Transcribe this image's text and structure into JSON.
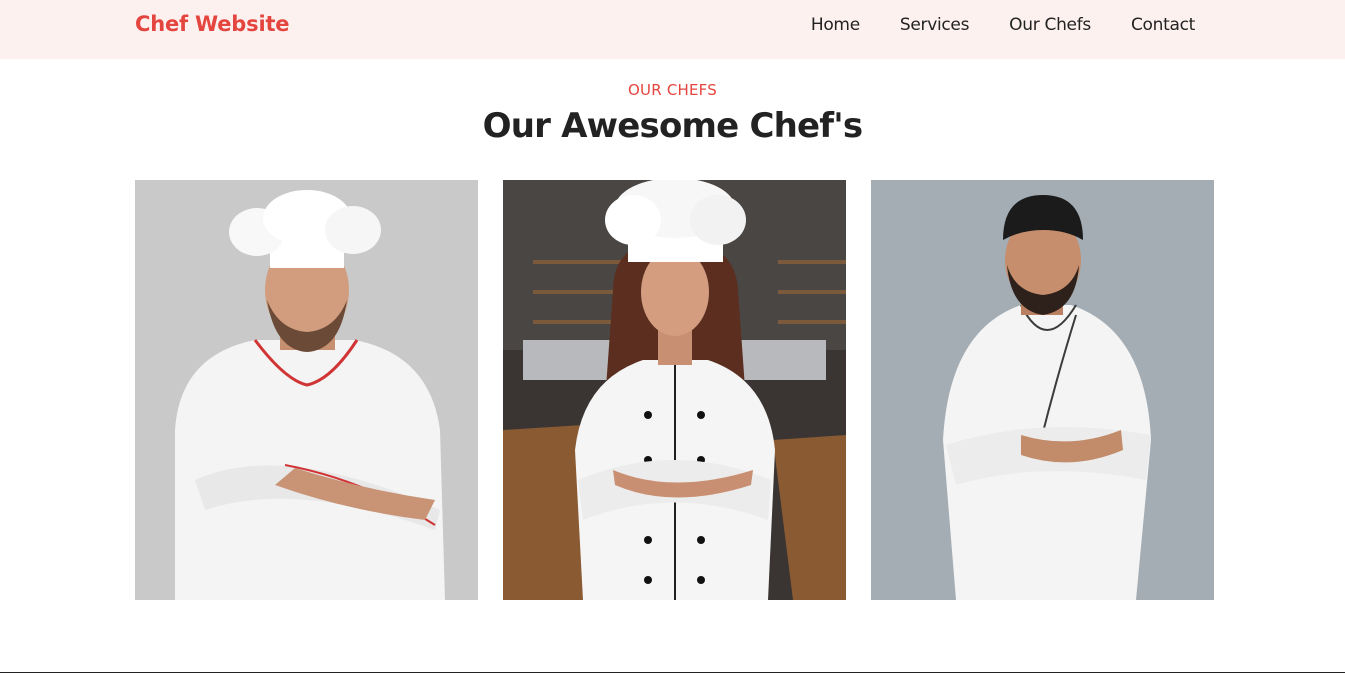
{
  "header": {
    "brand": "Chef Website",
    "nav": [
      "Home",
      "Services",
      "Our Chefs",
      "Contact"
    ]
  },
  "section": {
    "eyebrow": "OUR CHEFS",
    "title": "Our Awesome Chef's"
  },
  "chefs": [
    {
      "photo_icon": "chef-photo-icon",
      "hat": "white-toque",
      "background": "#c9c9c9"
    },
    {
      "photo_icon": "chef-photo-icon",
      "hat": "white-toque",
      "background": "#3a3532"
    },
    {
      "photo_icon": "chef-photo-icon",
      "hat": "black-skullcap",
      "background": "#a4adb4"
    }
  ],
  "colors": {
    "accent": "#e4453f",
    "nav_background": "#fdf1f0",
    "text": "#222222"
  }
}
